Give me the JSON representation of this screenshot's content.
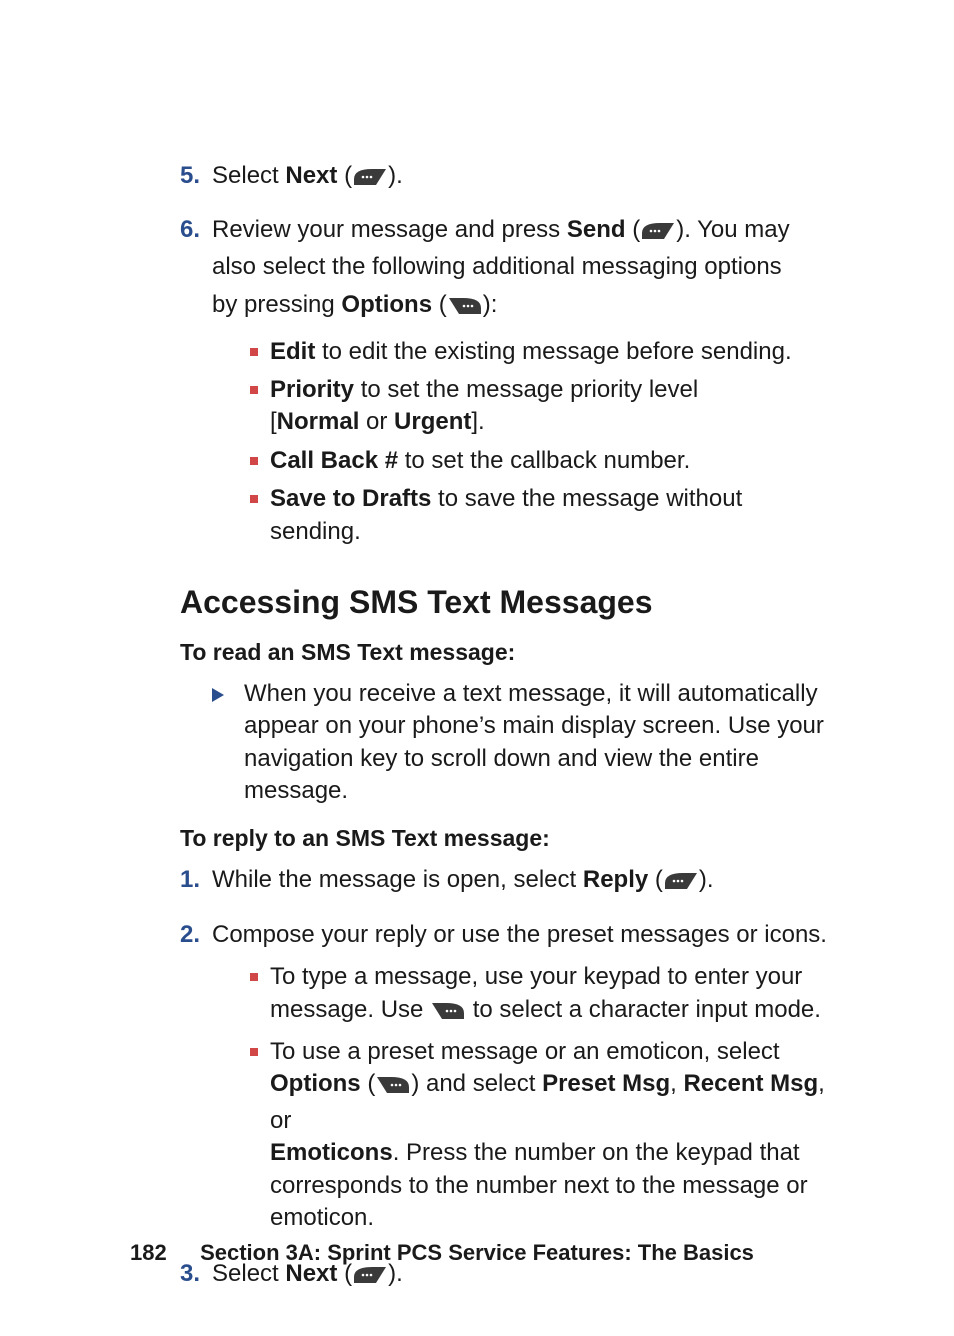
{
  "steps_top": {
    "s5": {
      "num": "5.",
      "pre": "Select ",
      "bold": "Next",
      "post": " (",
      "tail": ")."
    },
    "s6": {
      "num": "6.",
      "l1_pre": "Review your message and press ",
      "l1_bold": "Send",
      "l1_post": " (",
      "l1_tail": "). You may",
      "l2": "also select the following additional messaging options",
      "l3_pre": "by pressing ",
      "l3_bold": "Options",
      "l3_post": " (",
      "l3_tail": "):",
      "sub": [
        {
          "b": "Edit",
          "t": " to edit the existing message before sending."
        },
        {
          "b": "Priority",
          "t": " to set the message priority level",
          "t2_pre": "[",
          "t2_b1": "Normal",
          "t2_mid": " or ",
          "t2_b2": "Urgent",
          "t2_post": "]."
        },
        {
          "b": "Call Back #",
          "t": " to set the callback number."
        },
        {
          "b": "Save to Drafts",
          "t": " to save the message without sending."
        }
      ]
    }
  },
  "heading": "Accessing SMS Text Messages",
  "read_head": "To read an SMS Text message:",
  "read_body": {
    "l1": "When you receive a text message, it will automatically",
    "l2": "appear on your phone’s main display screen. Use your",
    "l3": "navigation key to scroll down and view the entire",
    "l4": "message."
  },
  "reply_head": "To reply to an SMS Text message:",
  "reply_steps": {
    "s1": {
      "num": "1.",
      "pre": "While the message is open, select ",
      "bold": "Reply",
      "post": " (",
      "tail": ")."
    },
    "s2": {
      "num": "2.",
      "l1": "Compose your reply or use the preset messages or icons.",
      "sub": [
        {
          "l1": "To type a message, use your keypad to enter your",
          "l2_pre": "message. Use ",
          "l2_post": " to select a character input mode."
        },
        {
          "l1": "To use a preset message or an emoticon, select",
          "l2_b1": "Options",
          "l2_p1": " (",
          "l2_p2": ") and select ",
          "l2_b2": "Preset Msg",
          "l2_c1": ", ",
          "l2_b3": "Recent Msg",
          "l2_c2": ", or",
          "l3_b": "Emoticons",
          "l3_t": ". Press the number on the keypad that",
          "l4": "corresponds to the number next to the message or",
          "l5": "emoticon."
        }
      ]
    },
    "s3": {
      "num": "3.",
      "pre": "Select ",
      "bold": "Next",
      "post": " (",
      "tail": ")."
    }
  },
  "footer": {
    "page": "182",
    "text": "Section 3A: Sprint PCS Service Features: The Basics"
  }
}
